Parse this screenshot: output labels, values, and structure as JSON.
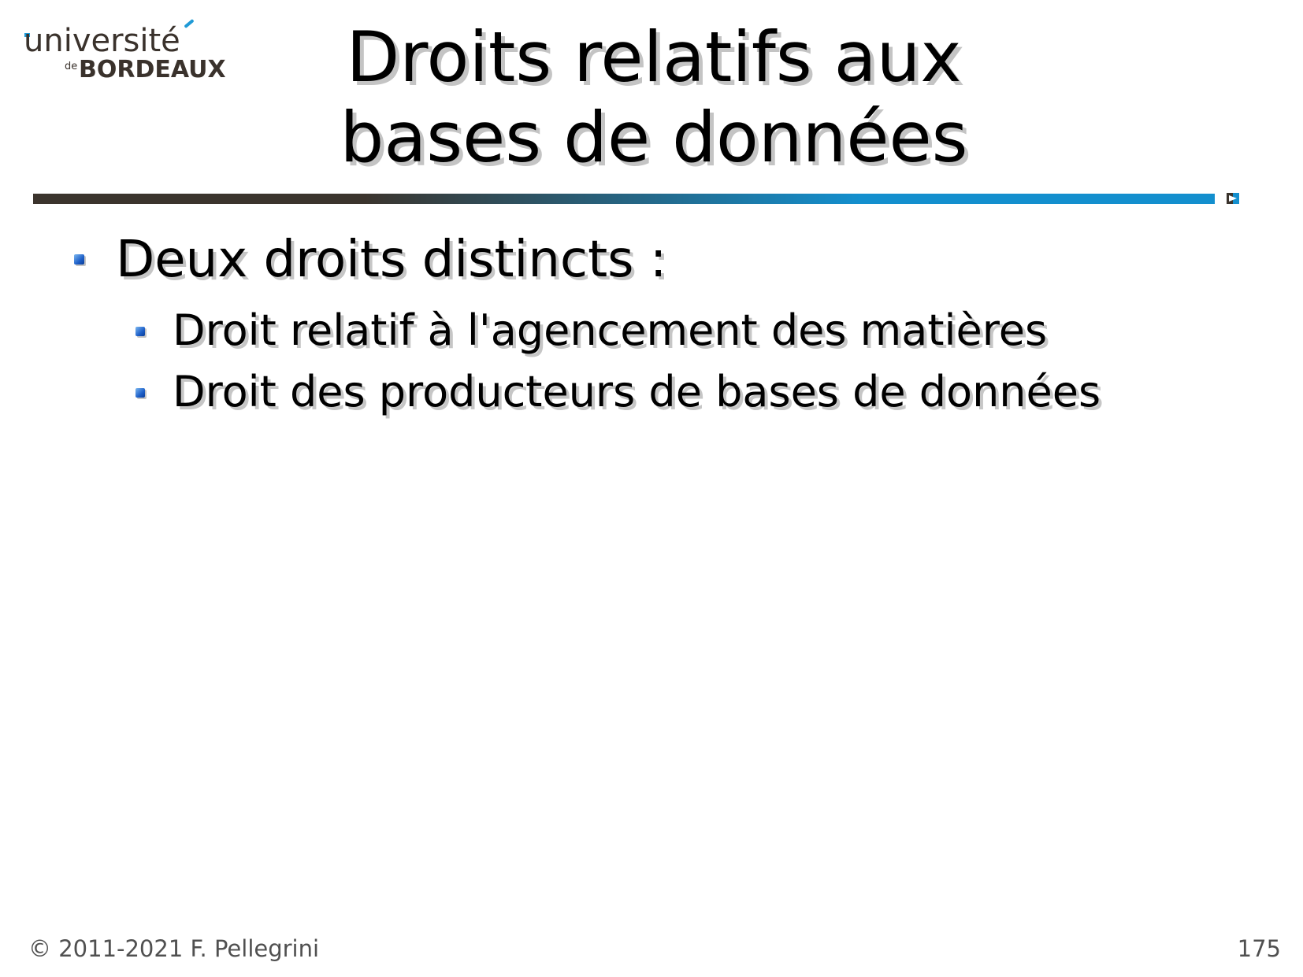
{
  "logo": {
    "line1": "université",
    "de": "de",
    "line2": "BORDEAUX"
  },
  "slide": {
    "title_line1": "Droits relatifs aux",
    "title_line2": "bases de données",
    "bullets": [
      {
        "text": "Deux droits distincts :",
        "children": [
          "Droit relatif à l'agencement des matières",
          "Droit des producteurs de bases de données"
        ]
      }
    ]
  },
  "footer": {
    "copyright": "© 2011-2021 F. Pellegrini",
    "page_number": "175"
  },
  "colors": {
    "rule_dark": "#3b342d",
    "rule_blue": "#138fce",
    "bullet_blue": "#1d5fc8",
    "logo_accent": "#1f9ad6",
    "logo_text": "#3a322c"
  },
  "icons": {
    "bullet": "blue-square-bullet-icon",
    "rule_end": "rule-end-marker-icon"
  }
}
